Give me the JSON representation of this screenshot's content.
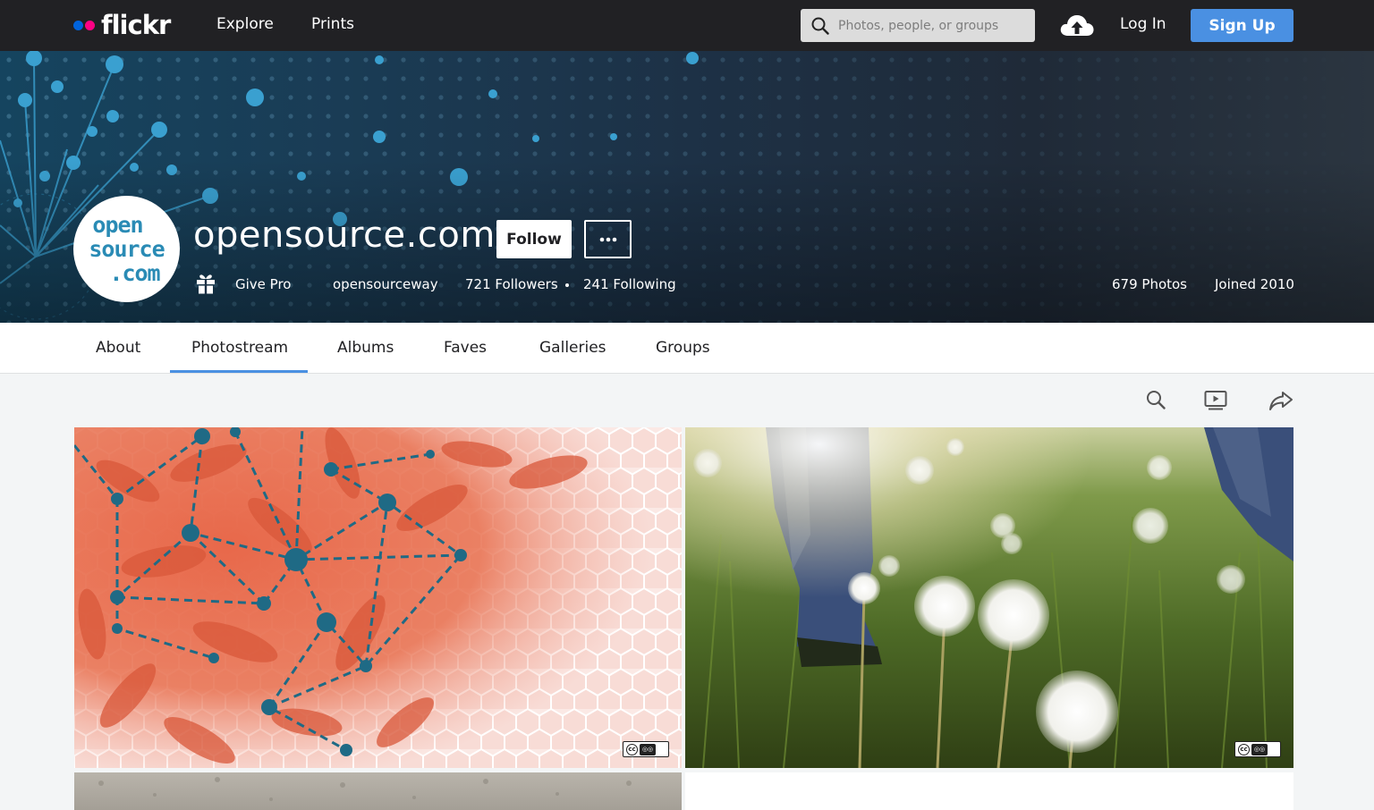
{
  "topbar": {
    "brand": "flickr",
    "nav": [
      "Explore",
      "Prints"
    ],
    "search_placeholder": "Photos, people, or groups",
    "login": "Log In",
    "signup": "Sign Up"
  },
  "profile": {
    "avatar_lines": [
      "open",
      "source",
      ".com"
    ],
    "name": "opensource.com",
    "follow": "Follow",
    "give_pro": "Give Pro",
    "username": "opensourceway",
    "followers": "721 Followers",
    "following": "241 Following",
    "photos": "679 Photos",
    "joined": "Joined 2010"
  },
  "tabs": [
    "About",
    "Photostream",
    "Albums",
    "Faves",
    "Galleries",
    "Groups"
  ],
  "active_tab": "Photostream",
  "colors": {
    "accent": "#4a90e2",
    "brand_blue": "#0063dc",
    "brand_pink": "#ff0084",
    "topbar": "#212124"
  },
  "icons": {
    "search": "search-icon",
    "upload": "cloud-upload-icon",
    "more": "more-dots-icon",
    "gift": "gift-icon",
    "slideshow": "slideshow-icon",
    "share": "share-icon",
    "license": "creative-commons-icon"
  }
}
